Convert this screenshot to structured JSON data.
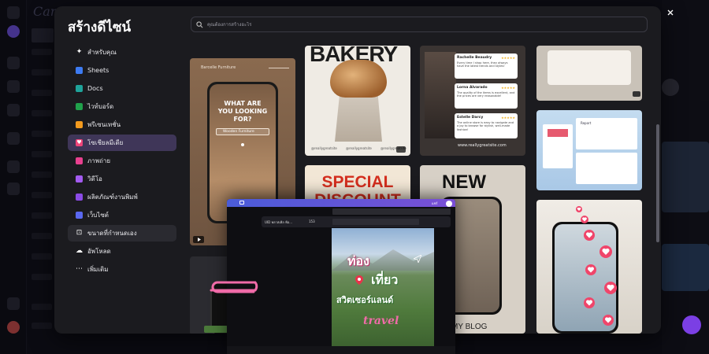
{
  "modal": {
    "title": "สร้างดีไซน์",
    "search_placeholder": "คุณต้องการสร้างอะไร",
    "menu": [
      {
        "label": "สำหรับคุณ",
        "icon": "sparkle-icon",
        "color": "#2a2a30"
      },
      {
        "label": "Sheets",
        "icon": "sheets-icon",
        "color": "#3d7bf2"
      },
      {
        "label": "Docs",
        "icon": "docs-icon",
        "color": "#1fa39a"
      },
      {
        "label": "ไวท์บอร์ด",
        "icon": "whiteboard-icon",
        "color": "#20a14b"
      },
      {
        "label": "พรีเซนเทชั่น",
        "icon": "presentation-icon",
        "color": "#f29a1e"
      },
      {
        "label": "โซเชียลมีเดีย",
        "icon": "heart-icon",
        "color": "#f0457a",
        "active": true
      },
      {
        "label": "ภาพถ่าย",
        "icon": "photo-icon",
        "color": "#e8408f"
      },
      {
        "label": "วิดีโอ",
        "icon": "video-icon",
        "color": "#a35bf0"
      },
      {
        "label": "ผลิตภัณฑ์งานพิมพ์",
        "icon": "print-icon",
        "color": "#8b4be6"
      },
      {
        "label": "เว็บไซต์",
        "icon": "website-icon",
        "color": "#5a68f0"
      },
      {
        "label": "ขนาดที่กำหนดเอง",
        "icon": "custom-size-icon",
        "color": "#2a2a30",
        "hover": true
      },
      {
        "label": "อัพโหลด",
        "icon": "upload-icon",
        "color": "#2a2a30"
      },
      {
        "label": "เพิ่มเติม",
        "icon": "more-icon",
        "color": "#2a2a30"
      }
    ]
  },
  "templates": {
    "furniture": {
      "brand": "Barcelle Furniture",
      "headline": "WHAT ARE YOU LOOKING FOR?",
      "search": "Wooden Furniture"
    },
    "bakery": {
      "title": "BAKERY",
      "handles": [
        "@reallygreatsite",
        "@reallygreatsite",
        "@reallygreatsite"
      ]
    },
    "reviews": {
      "items": [
        {
          "name": "Rachelle Beaudry",
          "text": "Every time I shop here, they always have the latest trends and styles!"
        },
        {
          "name": "Lorna Alvarado",
          "text": "The quality of the items is excellent, and the prices are very reasonable!"
        },
        {
          "name": "Estelle Darcy",
          "text": "The online store is easy to navigate and a joy to browse for stylish, well-made fashion!"
        }
      ],
      "site": "www.reallygreatsite.com"
    },
    "special": {
      "line1": "SPECIAL",
      "line2": "DISCOUNT"
    },
    "new_blog": {
      "title": "NEW",
      "footer": "MY BLOG"
    },
    "report": {
      "label": "Report"
    }
  },
  "editor": {
    "font_name": "UID พลาสเคิ่ล ฟ้อ...",
    "font_size": "153",
    "canvas_text": [
      "ท่อง",
      "เที่ยว",
      "สวิตเซอร์แลนด์"
    ],
    "canvas_script": "travel",
    "share": "แชร์"
  },
  "colors": {
    "accent": "#7b3fe4",
    "modal_bg": "#1b1b1f",
    "active_item": "#3f3658"
  }
}
